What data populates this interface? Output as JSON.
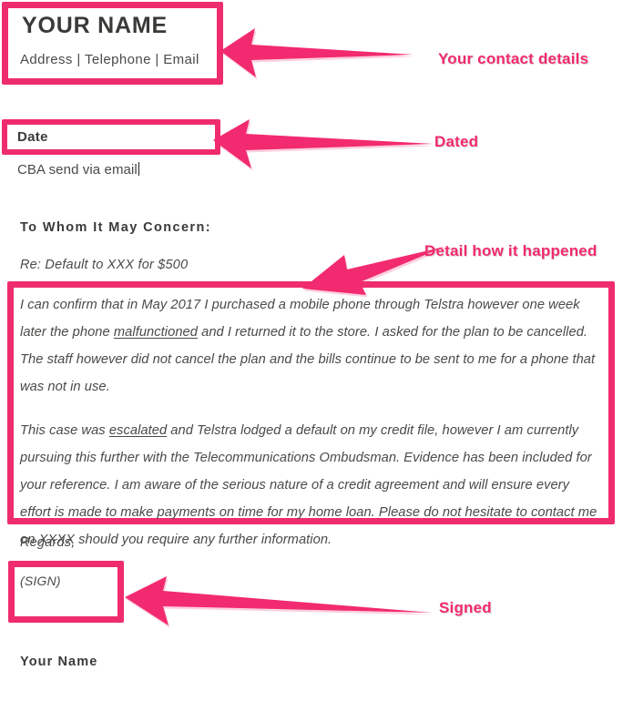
{
  "document": {
    "header": {
      "name": "YOUR NAME",
      "contact_line": "Address  |  Telephone  |  Email"
    },
    "date_label": "Date",
    "delivery_note": "CBA send via email",
    "salutation": "To Whom It May Concern:",
    "subject": "Re: Default to XXX for $500",
    "body": {
      "paragraph_1_part_1": "I can confirm that in May 2017 I purchased a mobile phone through Telstra however one week later the phone ",
      "paragraph_1_link": "malfunctioned",
      "paragraph_1_part_2": " and I returned it to the store. I asked for the plan to be cancelled. The staff however did not cancel the plan and the bills continue to be sent to me for a phone that was not in use.",
      "paragraph_2_part_1": "This case was ",
      "paragraph_2_link": "escalated",
      "paragraph_2_part_2": " and Telstra lodged a default on my credit file, however I am currently pursuing this further with the Telecommunications Ombudsman. Evidence has been included for your reference. I am aware of the serious nature of a credit agreement and will ensure every effort is made to make payments on time for my home loan. Please do not hesitate to contact me on XXXX should you require any further information."
    },
    "regards": "Regards,",
    "signature_placeholder": "(SIGN)",
    "closing_name": "Your Name"
  },
  "annotations": [
    {
      "id": "contact",
      "label": "Your contact details"
    },
    {
      "id": "dated",
      "label": "Dated"
    },
    {
      "id": "detail",
      "label": "Detail how it happened"
    },
    {
      "id": "signed",
      "label": "Signed"
    }
  ],
  "colors": {
    "accent_pink": "#ef2c6d",
    "annotation_pink": "#f22a6f",
    "text_dark": "#3b3a38",
    "text_body": "#4a4a48",
    "background": "#ffffff"
  }
}
